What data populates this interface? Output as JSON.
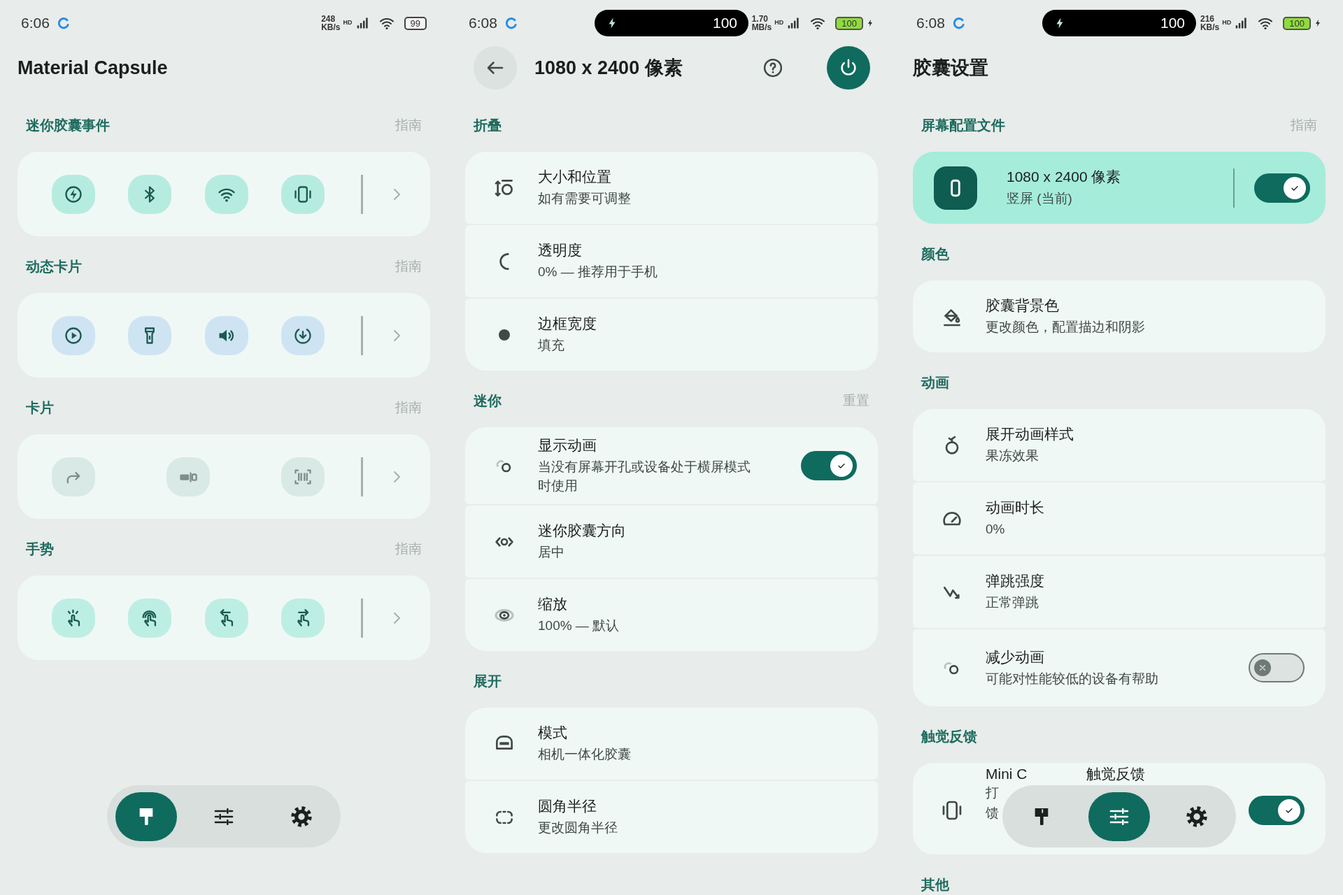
{
  "screens": [
    {
      "kind": "home",
      "status_bar": {
        "time": "6:06",
        "speed": "248",
        "speed_unit": "KB/s",
        "network": "HD",
        "battery": "99",
        "charging": false
      },
      "title": "Material Capsule",
      "sections": [
        {
          "label": "迷你胶囊事件",
          "action": "指南",
          "color": "#b6ece0",
          "disabled": false
        },
        {
          "label": "动态卡片",
          "action": "指南",
          "color": "#cfe4f3",
          "disabled": false
        },
        {
          "label": "卡片",
          "action": "指南",
          "color": "#d8e9e6",
          "disabled": true
        },
        {
          "label": "手势",
          "action": "指南",
          "color": "#bdeee4",
          "disabled": false
        }
      ],
      "nav": [
        {
          "selected": true
        },
        {
          "selected": false
        },
        {
          "selected": false
        }
      ]
    },
    {
      "kind": "detail",
      "status_bar": {
        "time": "6:08",
        "island": "100",
        "speed": "1.70",
        "speed_unit": "MB/s",
        "network": "HD",
        "battery": "100",
        "charging": true
      },
      "title": "1080 x 2400 像素",
      "power_on": true,
      "sections": [
        {
          "label": "折叠",
          "items": [
            {
              "kind": "row",
              "title": "大小和位置",
              "subtitle": "如有需要可调整"
            },
            {
              "kind": "row",
              "title": "透明度",
              "subtitle": "0% — 推荐用于手机"
            },
            {
              "kind": "row",
              "title": "边框宽度",
              "subtitle": "填充"
            }
          ]
        },
        {
          "label": "迷你",
          "action": "重置",
          "items": [
            {
              "kind": "toggle",
              "title": "显示动画",
              "subtitle": "当没有屏幕开孔或设备处于横屏模式时使用",
              "on": true
            },
            {
              "kind": "row",
              "title": "迷你胶囊方向",
              "subtitle": "居中"
            },
            {
              "kind": "row",
              "title": "缩放",
              "subtitle": "100% — 默认"
            }
          ]
        },
        {
          "label": "展开",
          "items": [
            {
              "kind": "row",
              "title": "模式",
              "subtitle": "相机一体化胶囊"
            },
            {
              "kind": "row",
              "title": "圆角半径",
              "subtitle": "更改圆角半径"
            }
          ]
        }
      ]
    },
    {
      "kind": "capsule",
      "status_bar": {
        "time": "6:08",
        "island": "100",
        "speed": "216",
        "speed_unit": "KB/s",
        "network": "HD",
        "battery": "100",
        "charging": true
      },
      "title": "胶囊设置",
      "sections": [
        {
          "label": "屏幕配置文件",
          "action": "指南",
          "items": [
            {
              "kind": "profile",
              "title": "1080 x 2400 像素",
              "subtitle": "竖屏 (当前)",
              "on": true
            }
          ]
        },
        {
          "label": "颜色",
          "items": [
            {
              "kind": "row",
              "title": "胶囊背景色",
              "subtitle": "更改颜色，配置描边和阴影"
            }
          ]
        },
        {
          "label": "动画",
          "items": [
            {
              "kind": "row",
              "title": "展开动画样式",
              "subtitle": "果冻效果"
            },
            {
              "kind": "row",
              "title": "动画时长",
              "subtitle": "0%"
            },
            {
              "kind": "row",
              "title": "弹跳强度",
              "subtitle": "正常弹跳"
            },
            {
              "kind": "toggle",
              "title": "减少动画",
              "subtitle": "可能对性能较低的设备有帮助",
              "on": false
            }
          ]
        },
        {
          "label": "触觉反馈",
          "items": [
            {
              "kind": "cut",
              "title_parts": [
                "Mini C",
                "触觉反馈"
              ],
              "subtitle_lines": [
                "打",
                "馈"
              ],
              "on": true
            }
          ]
        },
        {
          "label": "其他"
        }
      ],
      "nav": [
        {
          "selected": false
        },
        {
          "selected": true
        },
        {
          "selected": false
        }
      ]
    }
  ]
}
